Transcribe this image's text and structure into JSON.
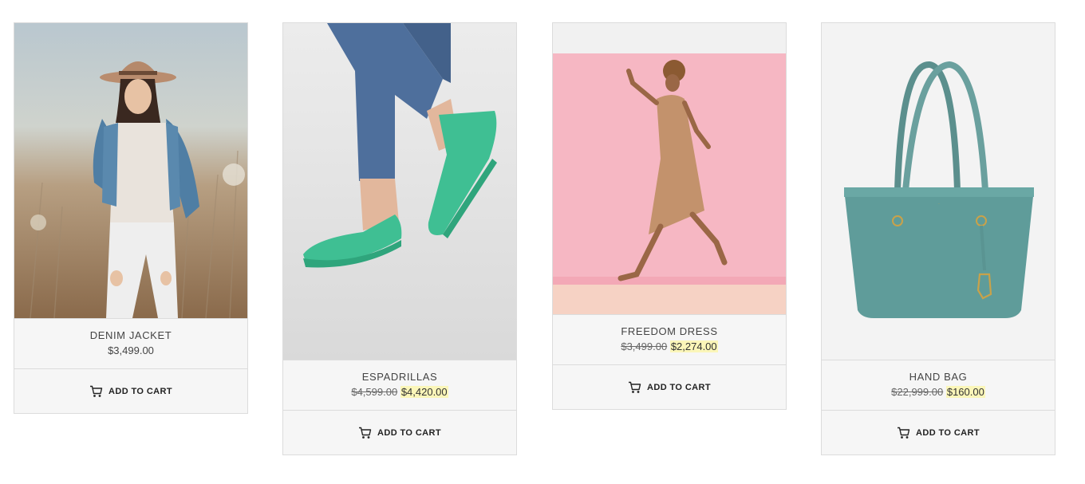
{
  "products": [
    {
      "name": "DENIM JACKET",
      "price": "$3,499.00",
      "image": "woman in denim jacket and hat in field",
      "cart_label": "ADD TO CART"
    },
    {
      "name": "ESPADRILLAS",
      "old_price": "$4,599.00",
      "price": "$4,420.00",
      "image": "green espadrille shoes with jeans",
      "cart_label": "ADD TO CART"
    },
    {
      "name": "FREEDOM DRESS",
      "old_price": "$3,499.00",
      "price": "$2,274.00",
      "image": "woman in tan dress jumping on pink background",
      "cart_label": "ADD TO CART"
    },
    {
      "name": "HAND BAG",
      "old_price": "$22,999.00",
      "price": "$160.00",
      "image": "teal leather tote hand bag",
      "cart_label": "ADD TO CART"
    }
  ],
  "icons": {
    "cart": "shopping-cart-icon"
  },
  "colors": {
    "sale_highlight": "#fbf6b9",
    "card_bg": "#f6f6f6",
    "border": "#dcdcdc"
  }
}
